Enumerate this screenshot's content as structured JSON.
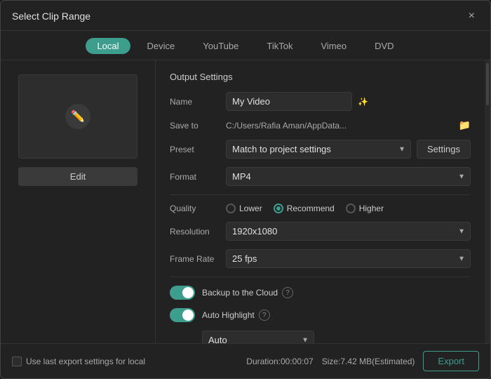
{
  "dialog": {
    "title": "Select Clip Range",
    "close_label": "×"
  },
  "tabs": [
    {
      "id": "local",
      "label": "Local",
      "active": true
    },
    {
      "id": "device",
      "label": "Device",
      "active": false
    },
    {
      "id": "youtube",
      "label": "YouTube",
      "active": false
    },
    {
      "id": "tiktok",
      "label": "TikTok",
      "active": false
    },
    {
      "id": "vimeo",
      "label": "Vimeo",
      "active": false
    },
    {
      "id": "dvd",
      "label": "DVD",
      "active": false
    }
  ],
  "left": {
    "edit_label": "Edit"
  },
  "output": {
    "section_title": "Output Settings",
    "name_label": "Name",
    "name_value": "My Video",
    "save_to_label": "Save to",
    "save_to_path": "C:/Users/Rafia Aman/AppData...",
    "preset_label": "Preset",
    "preset_value": "Match to project settings",
    "settings_label": "Settings",
    "format_label": "Format",
    "format_value": "MP4",
    "quality_label": "Quality",
    "quality_options": [
      {
        "id": "lower",
        "label": "Lower",
        "checked": false
      },
      {
        "id": "recommend",
        "label": "Recommend",
        "checked": true
      },
      {
        "id": "higher",
        "label": "Higher",
        "checked": false
      }
    ],
    "resolution_label": "Resolution",
    "resolution_value": "1920x1080",
    "frame_rate_label": "Frame Rate",
    "frame_rate_value": "25 fps",
    "backup_label": "Backup to the Cloud",
    "auto_highlight_label": "Auto Highlight",
    "auto_dropdown_value": "Auto"
  },
  "bottom": {
    "use_last_label": "Use last export settings for local",
    "duration_text": "Duration:00:00:07",
    "size_text": "Size:7.42 MB(Estimated)",
    "export_label": "Export"
  }
}
